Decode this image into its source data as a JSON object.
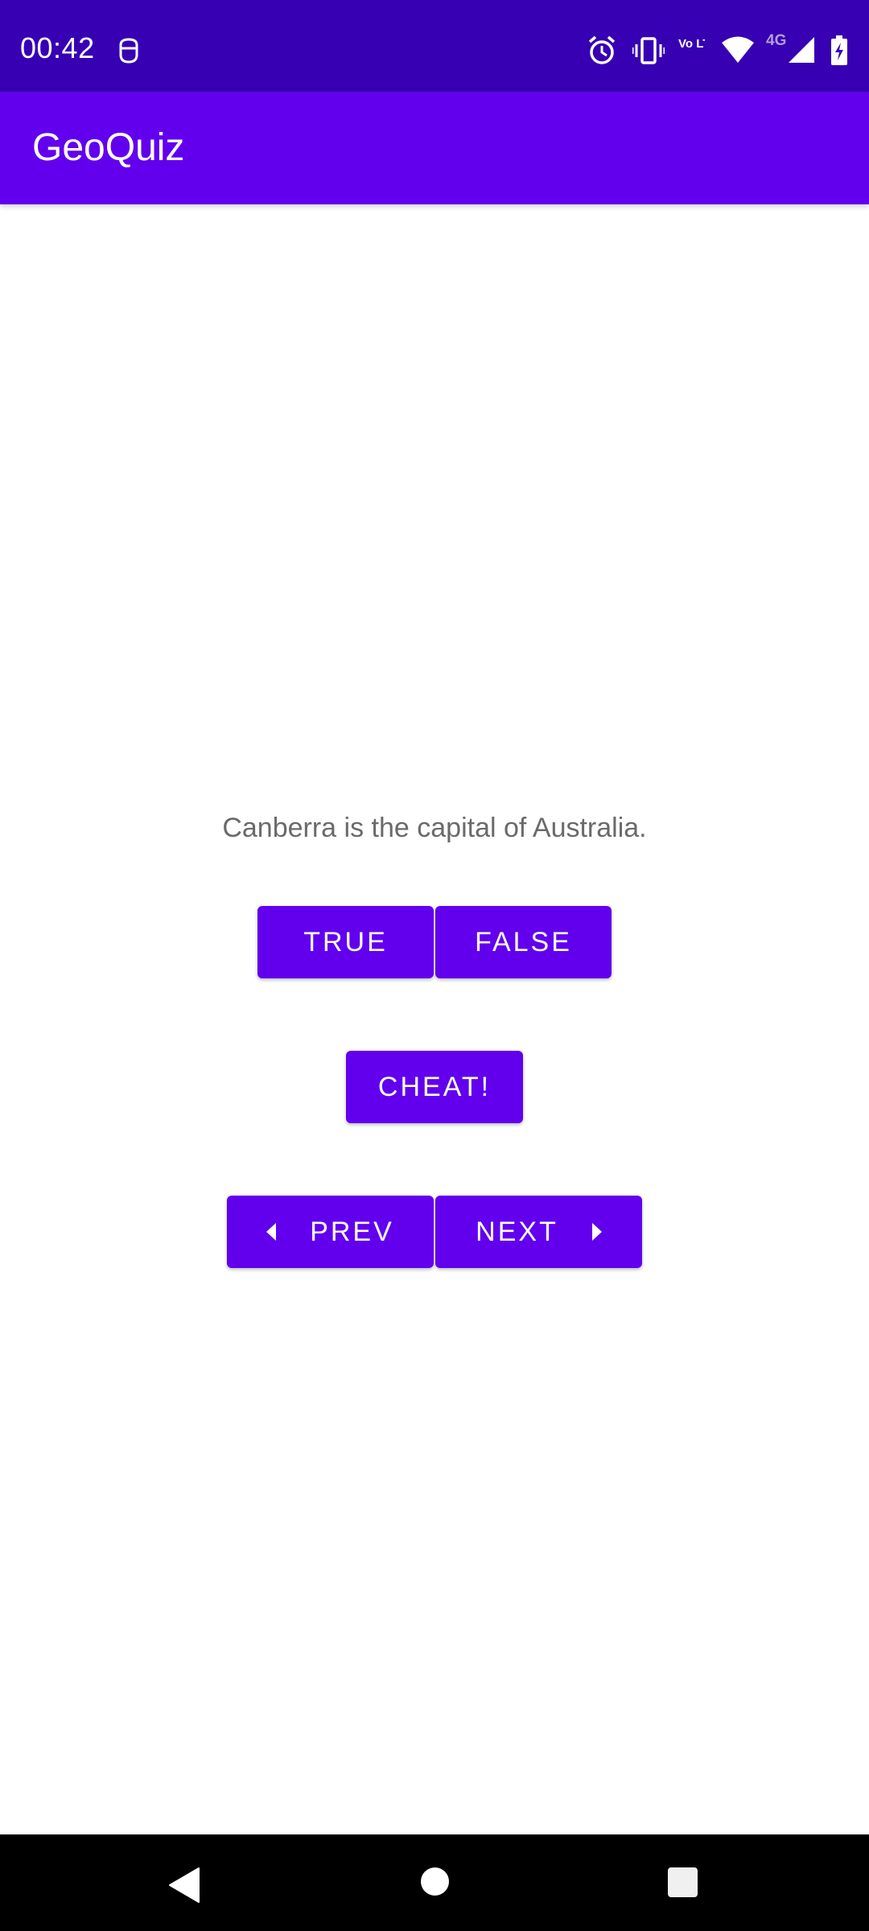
{
  "status_bar": {
    "time": "00:42",
    "network_label": "4G",
    "volte_label": "Vo LTE",
    "icons": [
      "face-unlock-icon",
      "alarm-icon",
      "vibrate-icon",
      "volte-icon",
      "wifi-icon",
      "cellular-signal-icon",
      "battery-charging-icon"
    ]
  },
  "app_bar": {
    "title": "GeoQuiz"
  },
  "quiz": {
    "question": "Canberra is the capital of Australia.",
    "true_label": "TRUE",
    "false_label": "FALSE",
    "cheat_label": "CHEAT!",
    "prev_label": "PREV",
    "next_label": "NEXT"
  },
  "nav_bar": {
    "icons": [
      "back-icon",
      "home-icon",
      "recents-icon"
    ]
  },
  "colors": {
    "status_bar": "#3700b3",
    "primary": "#6200ee",
    "question_text": "#6a6a6a"
  }
}
